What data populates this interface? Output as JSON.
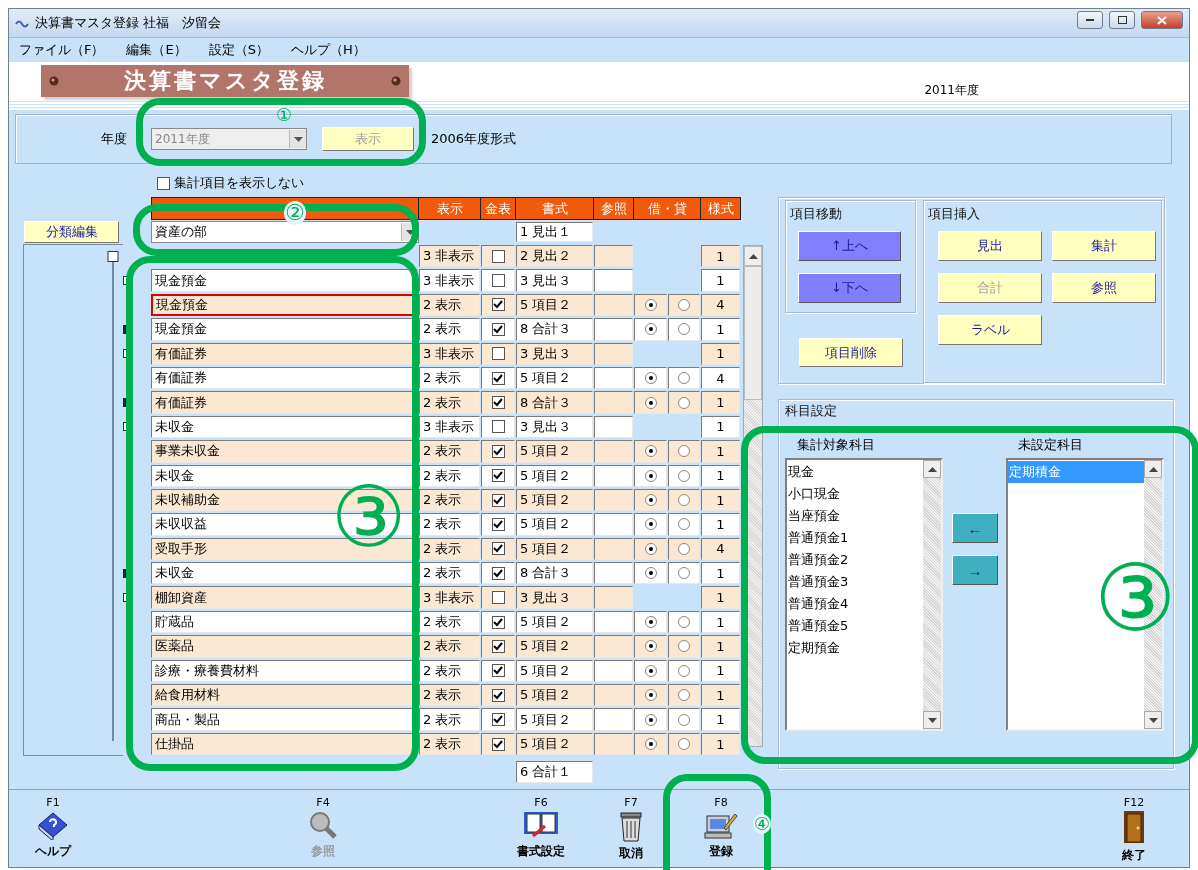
{
  "window": {
    "title": "決算書マスタ登録 社福　汐留会"
  },
  "menu": [
    "ファイル（F）",
    "編集（E）",
    "設定（S）",
    "ヘルプ（H）"
  ],
  "banner": {
    "title": "決算書マスタ登録"
  },
  "fiscal_year": "2011年度",
  "year_panel": {
    "label": "年度",
    "year": {
      "value": "2011年度",
      "disabled": true
    },
    "show_button": {
      "label": "表示",
      "disabled": true
    },
    "format_note": "2006年度形式"
  },
  "hide_totals": {
    "label": "集計項目を表示しない",
    "checked": false
  },
  "grid": {
    "columns": [
      "表示",
      "金表",
      "書式",
      "参照",
      "借・貸",
      "様式"
    ],
    "category_button": "分類編集",
    "category": "資産の部",
    "heading_format": "1 見出１",
    "rows": [
      {
        "kind": "root",
        "display": "3 非表示",
        "amount_shown": false,
        "format": "2 見出２",
        "style": "1",
        "shaded": true
      },
      {
        "kind": "heading",
        "name": "現金預金",
        "display": "3 非表示",
        "amount_shown": false,
        "format": "3 見出３",
        "style": "1",
        "shaded": false,
        "selected": false
      },
      {
        "kind": "item",
        "name": "現金預金",
        "display": "2 表示",
        "amount_shown": true,
        "format": "5 項目２",
        "debit": true,
        "style": "4",
        "shaded": true,
        "selected": true
      },
      {
        "kind": "total",
        "name": "現金預金",
        "display": "2 表示",
        "amount_shown": true,
        "format": "8 合計３",
        "debit": true,
        "style": "1",
        "shaded": false,
        "selected": false
      },
      {
        "kind": "heading",
        "name": "有価証券",
        "display": "3 非表示",
        "amount_shown": false,
        "format": "3 見出３",
        "style": "1",
        "shaded": true,
        "selected": false
      },
      {
        "kind": "item",
        "name": "有価証券",
        "display": "2 表示",
        "amount_shown": true,
        "format": "5 項目２",
        "debit": true,
        "style": "4",
        "shaded": false,
        "selected": false
      },
      {
        "kind": "total",
        "name": "有価証券",
        "display": "2 表示",
        "amount_shown": true,
        "format": "8 合計３",
        "debit": true,
        "style": "1",
        "shaded": true,
        "selected": false
      },
      {
        "kind": "heading",
        "name": "未収金",
        "display": "3 非表示",
        "amount_shown": false,
        "format": "3 見出３",
        "style": "1",
        "shaded": false,
        "selected": false
      },
      {
        "kind": "item",
        "name": "事業未収金",
        "display": "2 表示",
        "amount_shown": true,
        "format": "5 項目２",
        "debit": true,
        "style": "1",
        "shaded": true,
        "selected": false
      },
      {
        "kind": "item",
        "name": "未収金",
        "display": "2 表示",
        "amount_shown": true,
        "format": "5 項目２",
        "debit": true,
        "style": "1",
        "shaded": false,
        "selected": false
      },
      {
        "kind": "item",
        "name": "未収補助金",
        "display": "2 表示",
        "amount_shown": true,
        "format": "5 項目２",
        "debit": true,
        "style": "1",
        "shaded": true,
        "selected": false
      },
      {
        "kind": "item",
        "name": "未収収益",
        "display": "2 表示",
        "amount_shown": true,
        "format": "5 項目２",
        "debit": true,
        "style": "1",
        "shaded": false,
        "selected": false
      },
      {
        "kind": "item",
        "name": "受取手形",
        "display": "2 表示",
        "amount_shown": true,
        "format": "5 項目２",
        "debit": true,
        "style": "4",
        "shaded": true,
        "selected": false
      },
      {
        "kind": "total",
        "name": "未収金",
        "display": "2 表示",
        "amount_shown": true,
        "format": "8 合計３",
        "debit": true,
        "style": "1",
        "shaded": false,
        "selected": false
      },
      {
        "kind": "heading",
        "name": "棚卸資産",
        "display": "3 非表示",
        "amount_shown": false,
        "format": "3 見出３",
        "style": "1",
        "shaded": true,
        "selected": false
      },
      {
        "kind": "item",
        "name": "貯蔵品",
        "display": "2 表示",
        "amount_shown": true,
        "format": "5 項目２",
        "debit": true,
        "style": "1",
        "shaded": false,
        "selected": false
      },
      {
        "kind": "item",
        "name": "医薬品",
        "display": "2 表示",
        "amount_shown": true,
        "format": "5 項目２",
        "debit": true,
        "style": "1",
        "shaded": true,
        "selected": false
      },
      {
        "kind": "item",
        "name": "診療・療養費材料",
        "display": "2 表示",
        "amount_shown": true,
        "format": "5 項目２",
        "debit": true,
        "style": "1",
        "shaded": false,
        "selected": false
      },
      {
        "kind": "item",
        "name": "給食用材料",
        "display": "2 表示",
        "amount_shown": true,
        "format": "5 項目２",
        "debit": true,
        "style": "1",
        "shaded": true,
        "selected": false
      },
      {
        "kind": "item",
        "name": "商品・製品",
        "display": "2 表示",
        "amount_shown": true,
        "format": "5 項目２",
        "debit": true,
        "style": "1",
        "shaded": false,
        "selected": false
      },
      {
        "kind": "item",
        "name": "仕掛品",
        "display": "2 表示",
        "amount_shown": true,
        "format": "5 項目２",
        "debit": true,
        "style": "1",
        "shaded": true,
        "selected": false
      }
    ],
    "footer_format": "6 合計１"
  },
  "move": {
    "title": "項目移動",
    "buttons": [
      "↑上へ",
      "↓下へ"
    ],
    "delete_button": "項目削除"
  },
  "insert": {
    "title": "項目挿入",
    "buttons": [
      {
        "label": "見出",
        "disabled": false
      },
      {
        "label": "集計",
        "disabled": false
      },
      {
        "label": "合計",
        "disabled": true
      },
      {
        "label": "参照",
        "disabled": false
      },
      {
        "label": "ラベル",
        "disabled": false
      }
    ]
  },
  "account_settings": {
    "title": "科目設定",
    "target": {
      "title": "集計対象科目",
      "items": [
        {
          "label": "現金",
          "selected": false
        },
        {
          "label": "小口現金",
          "selected": false
        },
        {
          "label": "当座預金",
          "selected": false
        },
        {
          "label": "普通預金1",
          "selected": false
        },
        {
          "label": "普通預金2",
          "selected": false
        },
        {
          "label": "普通預金3",
          "selected": false
        },
        {
          "label": "普通預金4",
          "selected": false
        },
        {
          "label": "普通預金5",
          "selected": false
        },
        {
          "label": "定期預金",
          "selected": false
        }
      ]
    },
    "unset": {
      "title": "未設定科目",
      "items": [
        {
          "label": "定期積金",
          "selected": true
        }
      ]
    },
    "arrows": [
      "←",
      "→"
    ]
  },
  "toolbar": [
    {
      "key": "F1",
      "label": "ヘルプ",
      "kind": "help",
      "disabled": false
    },
    {
      "key": "F4",
      "label": "参照",
      "kind": "search",
      "disabled": true
    },
    {
      "key": "F6",
      "label": "書式設定",
      "kind": "format",
      "disabled": false
    },
    {
      "key": "F7",
      "label": "取消",
      "kind": "cancel",
      "disabled": false
    },
    {
      "key": "F8",
      "label": "登録",
      "kind": "register",
      "disabled": false
    },
    {
      "key": "F12",
      "label": "終了",
      "kind": "exit",
      "disabled": false
    }
  ],
  "annotations": [
    "①",
    "②",
    "③",
    "③",
    "④"
  ]
}
